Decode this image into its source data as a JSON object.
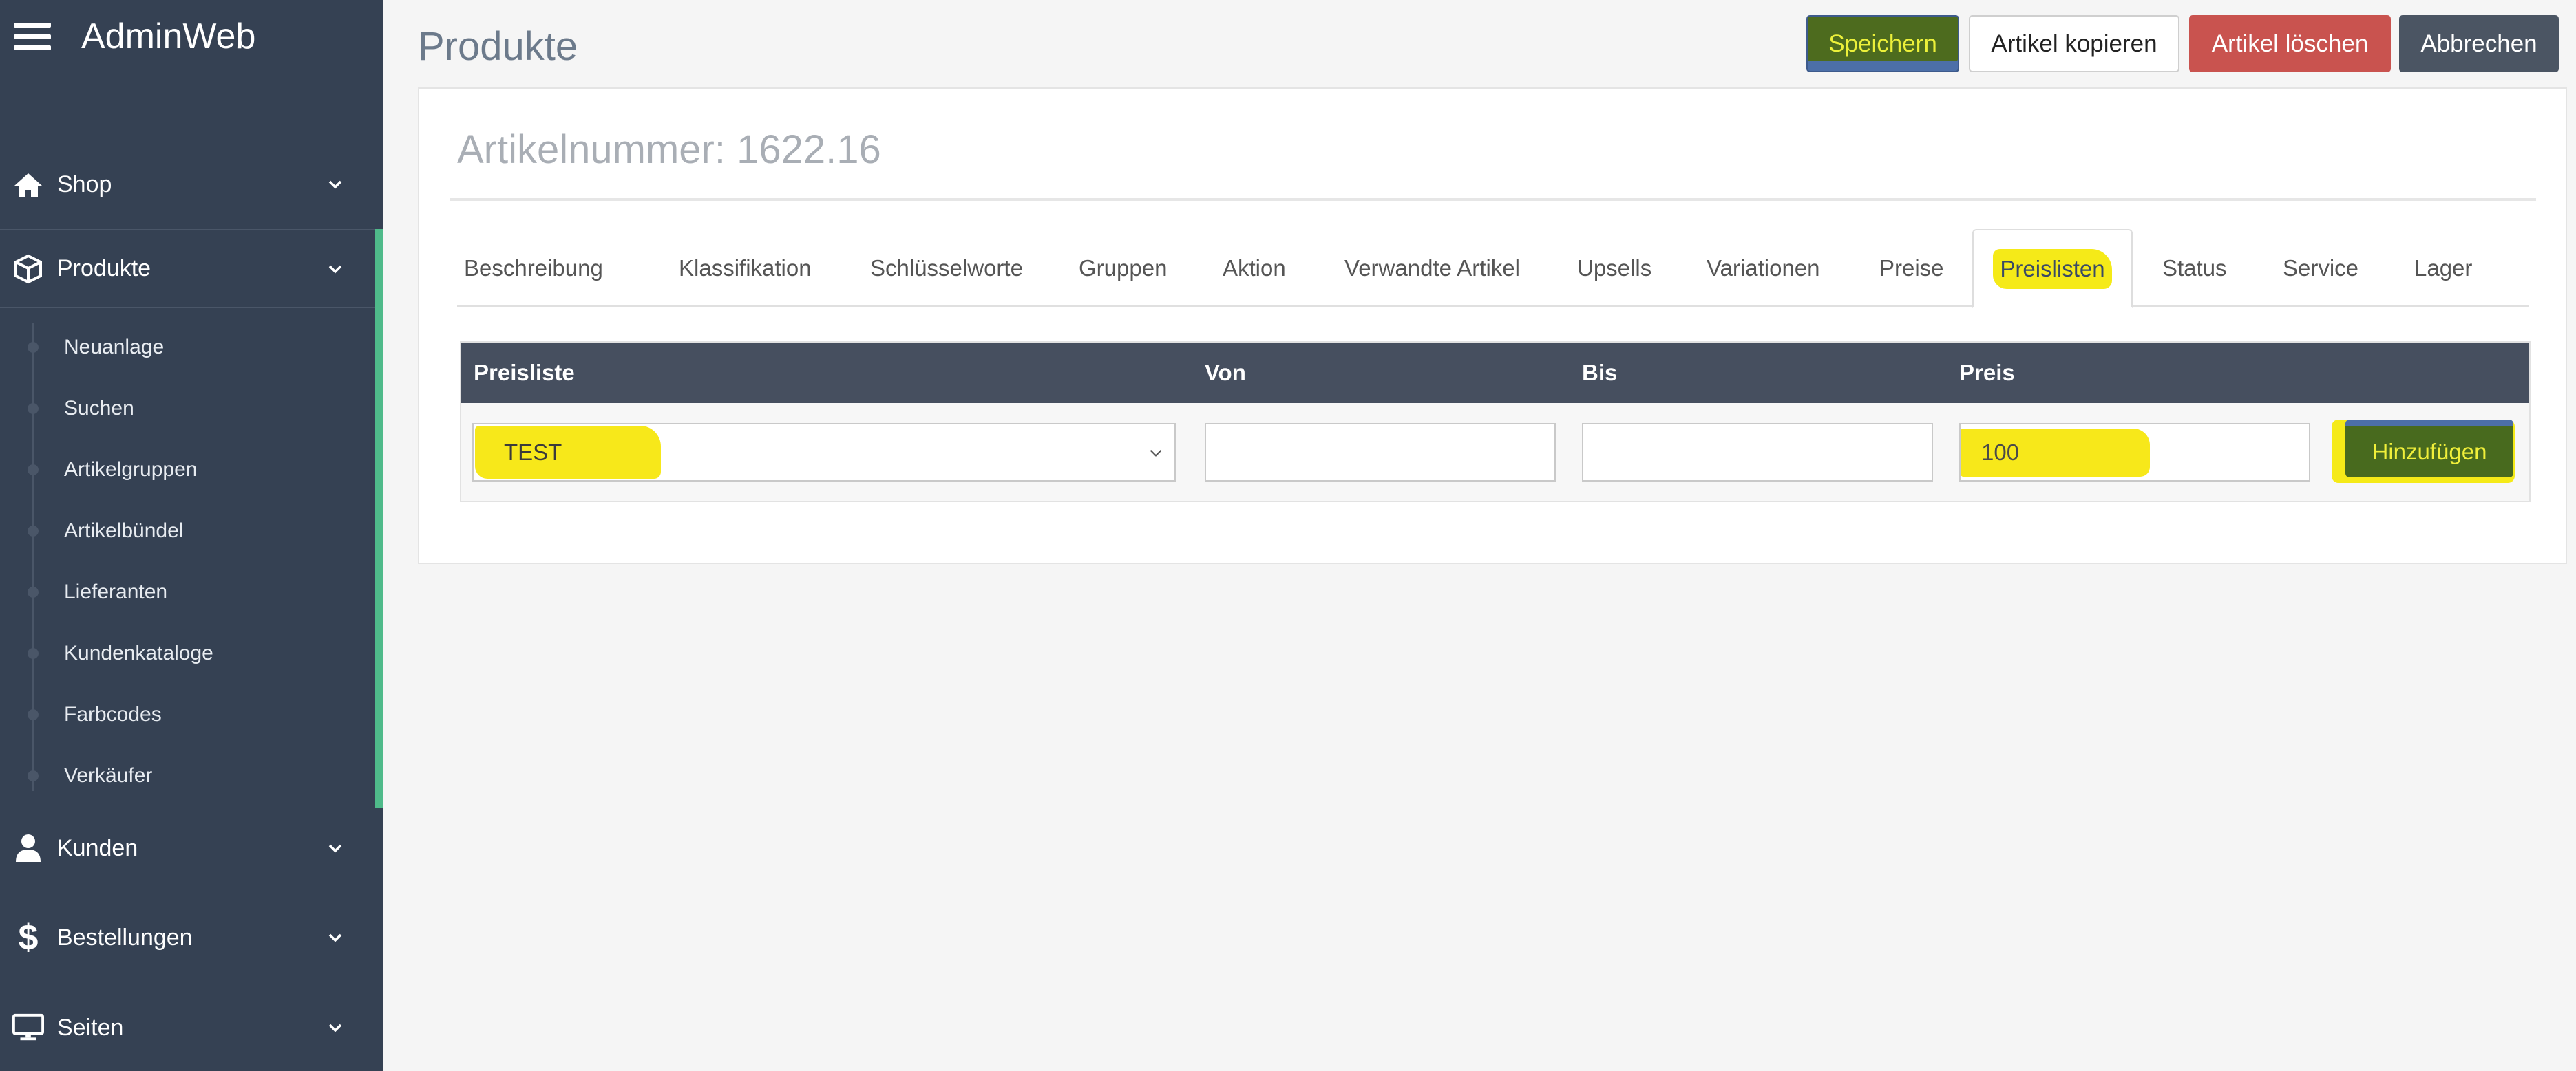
{
  "app": {
    "name": "AdminWeb"
  },
  "sidebar": {
    "items": [
      {
        "label": "Shop",
        "icon": "home-icon"
      },
      {
        "label": "Produkte",
        "icon": "cube-icon",
        "active": true
      },
      {
        "label": "Kunden",
        "icon": "user-icon"
      },
      {
        "label": "Bestellungen",
        "icon": "dollar-icon"
      },
      {
        "label": "Seiten",
        "icon": "monitor-icon"
      }
    ],
    "subitems": [
      "Neuanlage",
      "Suchen",
      "Artikelgruppen",
      "Artikelbündel",
      "Lieferanten",
      "Kundenkataloge",
      "Farbcodes",
      "Verkäufer"
    ]
  },
  "header": {
    "title": "Produkte",
    "buttons": {
      "save": "Speichern",
      "copy": "Artikel kopieren",
      "delete": "Artikel löschen",
      "cancel": "Abbrechen"
    }
  },
  "article": {
    "number_label": "Artikelnummer: 1622.16"
  },
  "tabs": [
    "Beschreibung",
    "Klassifikation",
    "Schlüsselworte",
    "Gruppen",
    "Aktion",
    "Verwandte Artikel",
    "Upsells",
    "Variationen",
    "Preise",
    "Preislisten",
    "Status",
    "Service",
    "Lager"
  ],
  "active_tab": "Preislisten",
  "pricelist_table": {
    "headers": {
      "preisliste": "Preisliste",
      "von": "Von",
      "bis": "Bis",
      "preis": "Preis"
    },
    "row": {
      "preisliste": "TEST",
      "von": "",
      "bis": "",
      "preis": "100"
    },
    "add_button": "Hinzufügen"
  },
  "colors": {
    "sidebar_bg": "#354153",
    "accent_green": "#4fba8a",
    "table_header_bg": "#464f5f",
    "delete_red": "#c9534f",
    "cancel_gray": "#4b5563",
    "highlight_yellow": "#f5ea18"
  }
}
